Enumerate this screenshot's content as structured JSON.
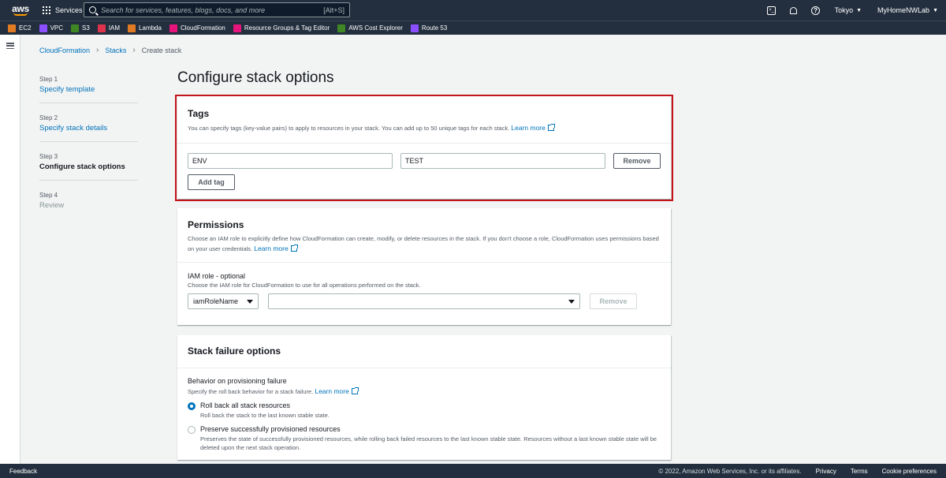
{
  "nav": {
    "logo_text": "aws",
    "services_label": "Services",
    "search_placeholder": "Search for services, features, blogs, docs, and more",
    "search_shortcut": "[Alt+S]",
    "region": "Tokyo",
    "account": "MyHomeNWLab"
  },
  "favorites": [
    {
      "label": "EC2",
      "color": "#e07b24"
    },
    {
      "label": "VPC",
      "color": "#8c4fff"
    },
    {
      "label": "S3",
      "color": "#3f8624"
    },
    {
      "label": "IAM",
      "color": "#dd344c"
    },
    {
      "label": "Lambda",
      "color": "#e07b24"
    },
    {
      "label": "CloudFormation",
      "color": "#e7157b"
    },
    {
      "label": "Resource Groups & Tag Editor",
      "color": "#e7157b"
    },
    {
      "label": "AWS Cost Explorer",
      "color": "#3f8624"
    },
    {
      "label": "Route 53",
      "color": "#8c4fff"
    }
  ],
  "breadcrumb": {
    "item1": "CloudFormation",
    "item2": "Stacks",
    "current": "Create stack"
  },
  "steps": [
    {
      "num": "Step 1",
      "label": "Specify template"
    },
    {
      "num": "Step 2",
      "label": "Specify stack details"
    },
    {
      "num": "Step 3",
      "label": "Configure stack options"
    },
    {
      "num": "Step 4",
      "label": "Review"
    }
  ],
  "page_title": "Configure stack options",
  "tags": {
    "title": "Tags",
    "description": "You can specify tags (key-value pairs) to apply to resources in your stack. You can add up to 50 unique tags for each stack.",
    "learn_more": "Learn more",
    "key_value": "ENV",
    "value_value": "TEST",
    "remove_label": "Remove",
    "add_tag_label": "Add tag"
  },
  "permissions": {
    "title": "Permissions",
    "description": "Choose an IAM role to explicitly define how CloudFormation can create, modify, or delete resources in the stack. If you don't choose a role, CloudFormation uses permissions based on your user credentials.",
    "learn_more": "Learn more",
    "iam_label": "IAM role - optional",
    "iam_desc": "Choose the IAM role for CloudFormation to use for all operations performed on the stack.",
    "select_value": "iamRoleName",
    "remove_label": "Remove"
  },
  "failure": {
    "title": "Stack failure options",
    "behavior_label": "Behavior on provisioning failure",
    "behavior_desc": "Specify the roll back behavior for a stack failure.",
    "learn_more": "Learn more",
    "option1_title": "Roll back all stack resources",
    "option1_desc": "Roll back the stack to the last known stable state.",
    "option2_title": "Preserve successfully provisioned resources",
    "option2_desc": "Preserves the state of successfully provisioned resources, while rolling back failed resources to the last known stable state. Resources without a last known stable state will be deleted upon the next stack operation."
  },
  "footer": {
    "feedback": "Feedback",
    "copyright": "© 2022, Amazon Web Services, Inc. or its affiliates.",
    "privacy": "Privacy",
    "terms": "Terms",
    "cookies": "Cookie preferences"
  }
}
